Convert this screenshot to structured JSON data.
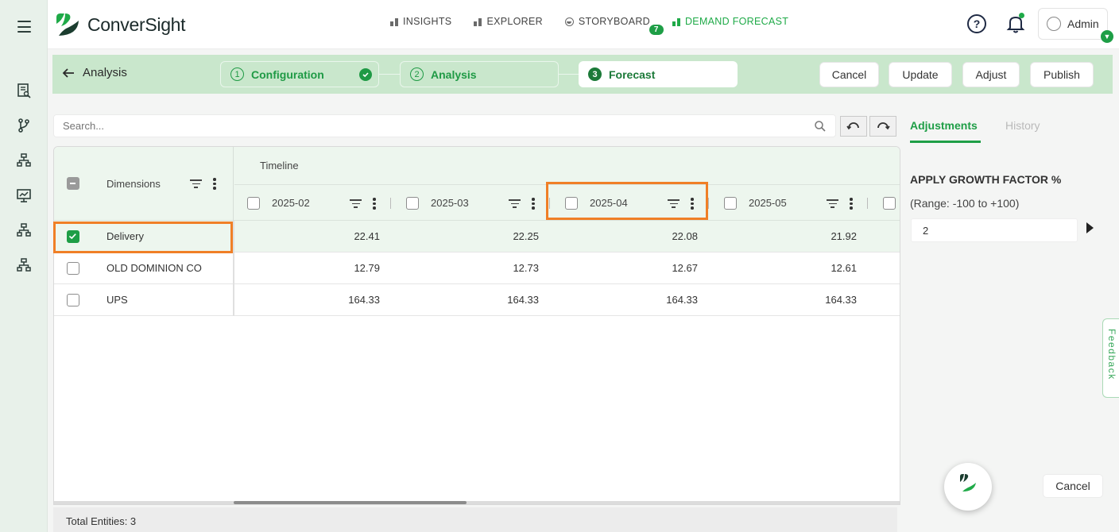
{
  "header": {
    "logo_text": "ConverSight",
    "nav": [
      {
        "label": "INSIGHTS",
        "active": false
      },
      {
        "label": "EXPLORER",
        "active": false
      },
      {
        "label": "STORYBOARD",
        "active": false,
        "badge": "7"
      },
      {
        "label": "DEMAND FORECAST",
        "active": true
      }
    ],
    "user": "Admin"
  },
  "stepbar": {
    "back_label": "Analysis",
    "steps": [
      {
        "num": "1",
        "label": "Configuration",
        "done": true
      },
      {
        "num": "2",
        "label": "Analysis",
        "done": false
      },
      {
        "num": "3",
        "label": "Forecast",
        "current": true
      }
    ],
    "buttons": {
      "cancel": "Cancel",
      "update": "Update",
      "adjust": "Adjust",
      "publish": "Publish"
    }
  },
  "search": {
    "placeholder": "Search..."
  },
  "table": {
    "dimensions_header": "Dimensions",
    "timeline_label": "Timeline",
    "columns": [
      "2025-02",
      "2025-03",
      "2025-04",
      "2025-05"
    ],
    "rows": [
      {
        "name": "Delivery",
        "checked": true,
        "values": [
          "22.41",
          "22.25",
          "22.08",
          "21.92"
        ]
      },
      {
        "name": "OLD DOMINION CO",
        "checked": false,
        "values": [
          "12.79",
          "12.73",
          "12.67",
          "12.61"
        ]
      },
      {
        "name": "UPS",
        "checked": false,
        "values": [
          "164.33",
          "164.33",
          "164.33",
          "164.33"
        ]
      }
    ],
    "footer": "Total Entities: 3"
  },
  "right_panel": {
    "tabs": [
      "Adjustments",
      "History"
    ],
    "growth_title": "APPLY GROWTH FACTOR %",
    "range": "(Range: -100 to +100)",
    "growth_value": "2",
    "cancel": "Cancel",
    "feedback": "Feedback"
  },
  "colors": {
    "accent": "#1e9e46",
    "highlight": "#f07f27",
    "stepbar": "#c9e7cc"
  }
}
